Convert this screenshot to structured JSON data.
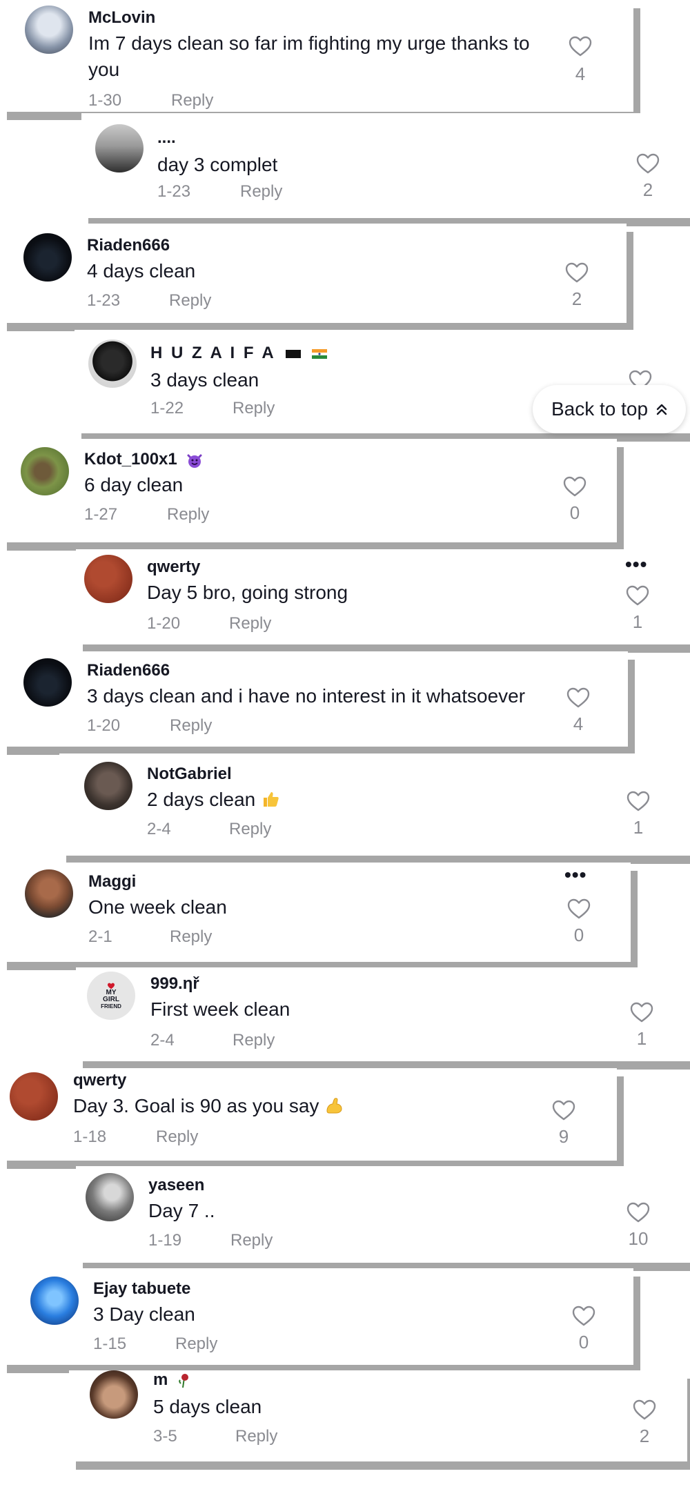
{
  "ui": {
    "reply_label": "Reply",
    "back_to_top_label": "Back to top"
  },
  "comments": [
    {
      "name": "McLovin",
      "text": "Im 7 days clean so far im fighting my urge thanks to you",
      "date": "1-30",
      "likes": "4"
    },
    {
      "name": "....",
      "text": "day 3 complet",
      "date": "1-23",
      "likes": "2"
    },
    {
      "name": "Riaden666",
      "text": "4 days clean",
      "date": "1-23",
      "likes": "2"
    },
    {
      "name": "H U Z A I F A",
      "text": "3 days clean",
      "date": "1-22",
      "likes": ""
    },
    {
      "name": "Kdot_100x1",
      "text": "6 day clean",
      "date": "1-27",
      "likes": "0"
    },
    {
      "name": "qwerty",
      "text": "Day 5 bro, going strong",
      "date": "1-20",
      "likes": "1"
    },
    {
      "name": "Riaden666",
      "text": "3 days clean and i have no interest in it whatsoever",
      "date": "1-20",
      "likes": "4"
    },
    {
      "name": "NotGabriel",
      "text": "2 days clean",
      "date": "2-4",
      "likes": "1"
    },
    {
      "name": "Maggi",
      "text": "One week clean",
      "date": "2-1",
      "likes": "0"
    },
    {
      "name": "999.ηř",
      "text": "First week clean",
      "date": "2-4",
      "likes": "1"
    },
    {
      "name": "qwerty",
      "text": "Day 3. Goal is 90 as you say",
      "date": "1-18",
      "likes": "9"
    },
    {
      "name": "yaseen",
      "text": "Day 7 ..",
      "date": "1-19",
      "likes": "10"
    },
    {
      "name": "Ejay tabuete",
      "text": "3 Day clean",
      "date": "1-15",
      "likes": "0"
    },
    {
      "name": "m",
      "text": "5 days clean",
      "date": "3-5",
      "likes": "2"
    }
  ],
  "avatar_logo_text": [
    "MY",
    "GIRL",
    "FRIEND"
  ],
  "colors": {
    "text": "#161823",
    "muted": "#8a8b91",
    "shadow": "#a6a6a6"
  }
}
